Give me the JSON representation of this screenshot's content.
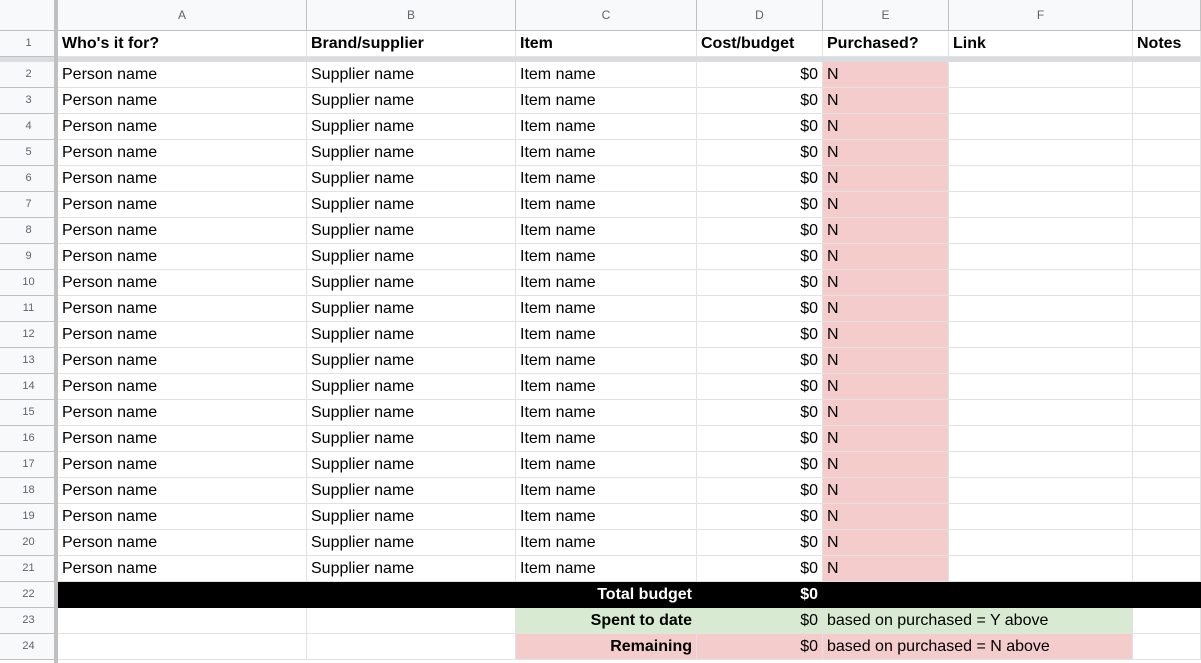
{
  "columns": [
    "A",
    "B",
    "C",
    "D",
    "E",
    "F",
    ""
  ],
  "header_row": {
    "num": "1",
    "cells": [
      "Who's it for?",
      "Brand/supplier",
      "Item",
      "Cost/budget",
      "Purchased?",
      "Link",
      "Notes"
    ]
  },
  "rows": [
    {
      "num": "2",
      "person": "Person name",
      "supplier": "Supplier name",
      "item": "Item name",
      "cost": "$0",
      "purchased": "N"
    },
    {
      "num": "3",
      "person": "Person name",
      "supplier": "Supplier name",
      "item": "Item name",
      "cost": "$0",
      "purchased": "N"
    },
    {
      "num": "4",
      "person": "Person name",
      "supplier": "Supplier name",
      "item": "Item name",
      "cost": "$0",
      "purchased": "N"
    },
    {
      "num": "5",
      "person": "Person name",
      "supplier": "Supplier name",
      "item": "Item name",
      "cost": "$0",
      "purchased": "N"
    },
    {
      "num": "6",
      "person": "Person name",
      "supplier": "Supplier name",
      "item": "Item name",
      "cost": "$0",
      "purchased": "N"
    },
    {
      "num": "7",
      "person": "Person name",
      "supplier": "Supplier name",
      "item": "Item name",
      "cost": "$0",
      "purchased": "N"
    },
    {
      "num": "8",
      "person": "Person name",
      "supplier": "Supplier name",
      "item": "Item name",
      "cost": "$0",
      "purchased": "N"
    },
    {
      "num": "9",
      "person": "Person name",
      "supplier": "Supplier name",
      "item": "Item name",
      "cost": "$0",
      "purchased": "N"
    },
    {
      "num": "10",
      "person": "Person name",
      "supplier": "Supplier name",
      "item": "Item name",
      "cost": "$0",
      "purchased": "N"
    },
    {
      "num": "11",
      "person": "Person name",
      "supplier": "Supplier name",
      "item": "Item name",
      "cost": "$0",
      "purchased": "N"
    },
    {
      "num": "12",
      "person": "Person name",
      "supplier": "Supplier name",
      "item": "Item name",
      "cost": "$0",
      "purchased": "N"
    },
    {
      "num": "13",
      "person": "Person name",
      "supplier": "Supplier name",
      "item": "Item name",
      "cost": "$0",
      "purchased": "N"
    },
    {
      "num": "14",
      "person": "Person name",
      "supplier": "Supplier name",
      "item": "Item name",
      "cost": "$0",
      "purchased": "N"
    },
    {
      "num": "15",
      "person": "Person name",
      "supplier": "Supplier name",
      "item": "Item name",
      "cost": "$0",
      "purchased": "N"
    },
    {
      "num": "16",
      "person": "Person name",
      "supplier": "Supplier name",
      "item": "Item name",
      "cost": "$0",
      "purchased": "N"
    },
    {
      "num": "17",
      "person": "Person name",
      "supplier": "Supplier name",
      "item": "Item name",
      "cost": "$0",
      "purchased": "N"
    },
    {
      "num": "18",
      "person": "Person name",
      "supplier": "Supplier name",
      "item": "Item name",
      "cost": "$0",
      "purchased": "N"
    },
    {
      "num": "19",
      "person": "Person name",
      "supplier": "Supplier name",
      "item": "Item name",
      "cost": "$0",
      "purchased": "N"
    },
    {
      "num": "20",
      "person": "Person name",
      "supplier": "Supplier name",
      "item": "Item name",
      "cost": "$0",
      "purchased": "N"
    },
    {
      "num": "21",
      "person": "Person name",
      "supplier": "Supplier name",
      "item": "Item name",
      "cost": "$0",
      "purchased": "N"
    }
  ],
  "summary": [
    {
      "num": "22",
      "label": "Total budget",
      "value": "$0",
      "note": ""
    },
    {
      "num": "23",
      "label": "Spent to date",
      "value": "$0",
      "note": "based on purchased = Y above"
    },
    {
      "num": "24",
      "label": "Remaining",
      "value": "$0",
      "note": "based on purchased = N above"
    }
  ],
  "colors": {
    "not_purchased": "#f4cccc",
    "spent": "#d9ead3",
    "total": "#000000"
  }
}
